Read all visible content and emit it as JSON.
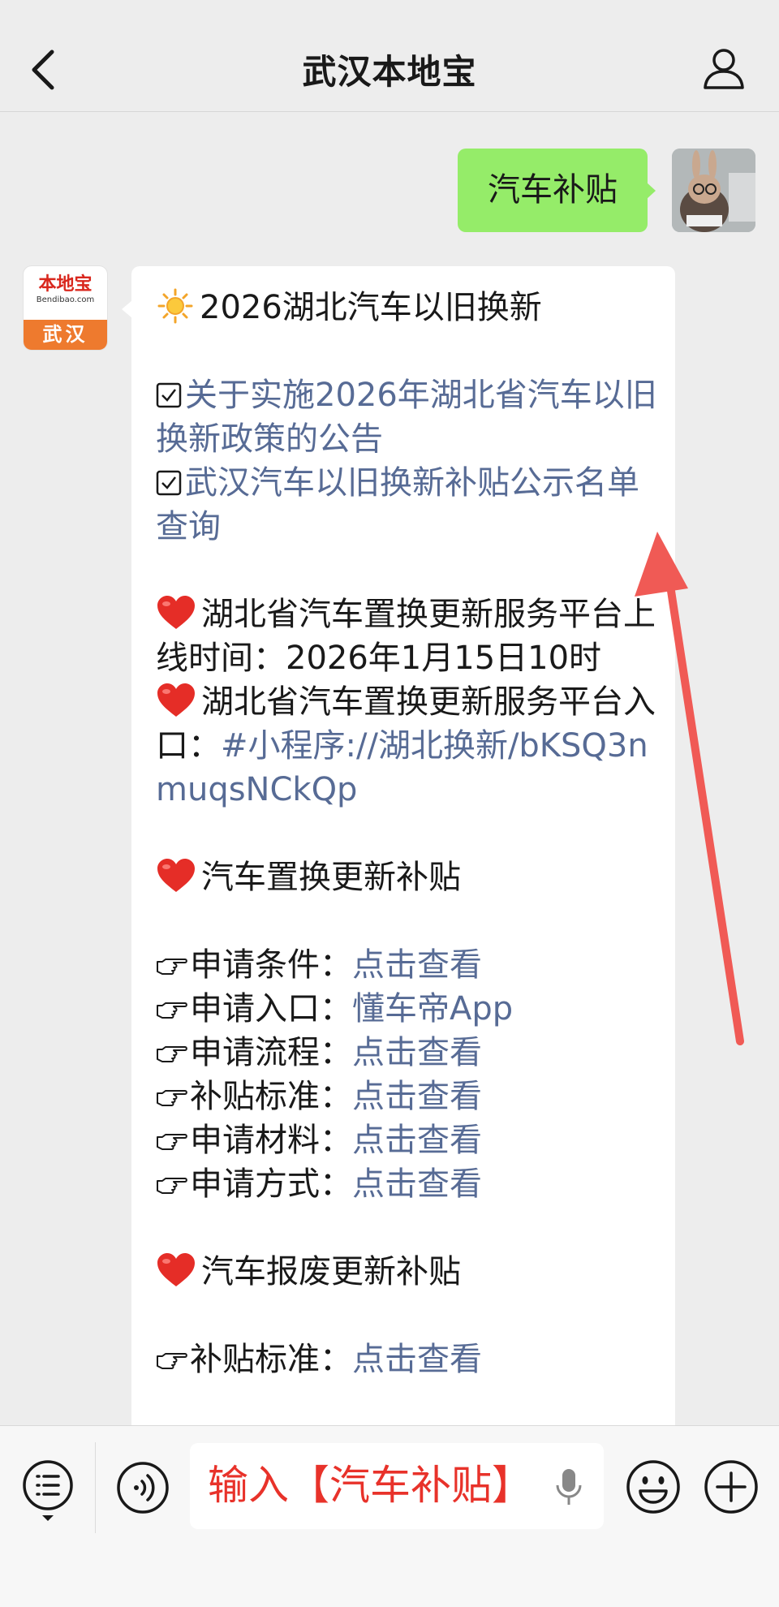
{
  "header": {
    "title": "武汉本地宝",
    "back_icon": "chevron-left-icon",
    "profile_icon": "person-icon"
  },
  "outgoing": {
    "text": "汽车补贴",
    "bubble_color": "#95ec69"
  },
  "sender_avatar": {
    "brand": "本地宝",
    "domain": "Bendibao.com",
    "city": "武汉",
    "city_color": "#ee7a2e"
  },
  "message": {
    "heading": "2026湖北汽车以旧换新",
    "links": [
      "关于实施2026年湖北省汽车以旧换新政策的公告",
      "武汉汽车以旧换新补贴公示名单查询"
    ],
    "platform_time_label": "湖北省汽车置换更新服务平台上线时间：",
    "platform_time_value": "2026年1月15日10时",
    "platform_entry_label": "湖北省汽车置换更新服务平台入口：",
    "platform_entry_link": "#小程序://湖北换新/bKSQ3nmuqsNCkQp",
    "section1_title": "汽车置换更新补贴",
    "section1_items": [
      {
        "label": "申请条件：",
        "link": "点击查看"
      },
      {
        "label": "申请入口：",
        "link": "懂车帝App"
      },
      {
        "label": "申请流程：",
        "link": "点击查看"
      },
      {
        "label": "补贴标准：",
        "link": "点击查看"
      },
      {
        "label": "申请材料：",
        "link": "点击查看"
      },
      {
        "label": "申请方式：",
        "link": "点击查看"
      }
    ],
    "section2_title": "汽车报废更新补贴",
    "section2_items": [
      {
        "label": "补贴标准：",
        "link": "点击查看"
      }
    ],
    "link_color": "#576b95"
  },
  "annotation": {
    "arrow_color": "#f05a55"
  },
  "bottom_bar": {
    "input_text": "输入【汽车补贴】",
    "input_text_color": "#e8322a",
    "icons": [
      "menu-icon",
      "voice-icon",
      "mic-icon",
      "emoji-icon",
      "plus-icon"
    ]
  }
}
